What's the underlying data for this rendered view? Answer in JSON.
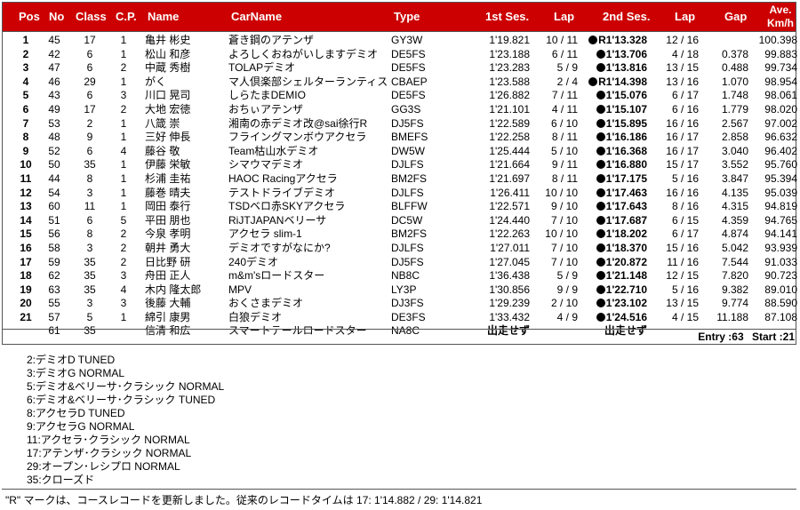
{
  "header": {
    "pos": "Pos",
    "no": "No",
    "class": "Class",
    "cp": "C.P.",
    "name": "Name",
    "carname": "CarName",
    "type": "Type",
    "ses1": "1st Ses.",
    "lap1": "Lap",
    "ses2": "2nd Ses.",
    "lap2": "Lap",
    "gap": "Gap",
    "ave1": "Ave.",
    "ave2": "Km/h"
  },
  "rows": [
    {
      "pos": "1",
      "no": "45",
      "cls": "17",
      "cp": "1",
      "name": "亀井 彬史",
      "car": "蒼き鋼のアテンザ",
      "type": "GY3W",
      "s1": "1'19.821",
      "l1": "10 / 11",
      "rec": true,
      "s2": "R1'13.328",
      "l2": "12 / 16",
      "gap": "",
      "ave": "100.398"
    },
    {
      "pos": "2",
      "no": "42",
      "cls": "6",
      "cp": "1",
      "name": "松山 和彦",
      "car": "よろしくおねがいしますデミオ",
      "type": "DE5FS",
      "s1": "1'23.188",
      "l1": "6 / 11",
      "rec": true,
      "s2": "1'13.706",
      "l2": "4 / 18",
      "gap": "0.378",
      "ave": "99.883"
    },
    {
      "pos": "3",
      "no": "47",
      "cls": "6",
      "cp": "2",
      "name": "中蔵 秀樹",
      "car": "TOLAPデミオ",
      "type": "DE5FS",
      "s1": "1'23.283",
      "l1": "5 / 9",
      "rec": true,
      "s2": "1'13.816",
      "l2": "13 / 15",
      "gap": "0.488",
      "ave": "99.734"
    },
    {
      "pos": "4",
      "no": "46",
      "cls": "29",
      "cp": "1",
      "name": "がく",
      "car": "マ人倶楽部シェルターランティス",
      "type": "CBAEP",
      "s1": "1'23.588",
      "l1": "2 / 4",
      "rec": true,
      "s2": "R1'14.398",
      "l2": "13 / 16",
      "gap": "1.070",
      "ave": "98.954"
    },
    {
      "pos": "5",
      "no": "43",
      "cls": "6",
      "cp": "3",
      "name": "川口 晃司",
      "car": "しらたまDEMIO",
      "type": "DE5FS",
      "s1": "1'26.882",
      "l1": "7 / 11",
      "rec": true,
      "s2": "1'15.076",
      "l2": "6 / 17",
      "gap": "1.748",
      "ave": "98.061"
    },
    {
      "pos": "6",
      "no": "49",
      "cls": "17",
      "cp": "2",
      "name": "大地 宏徳",
      "car": "おちぃアテンザ",
      "type": "GG3S",
      "s1": "1'21.101",
      "l1": "4 / 11",
      "rec": true,
      "s2": "1'15.107",
      "l2": "6 / 16",
      "gap": "1.779",
      "ave": "98.020"
    },
    {
      "pos": "7",
      "no": "53",
      "cls": "2",
      "cp": "1",
      "name": "八箴 崇",
      "car": "湘南の赤デミオ改@sai徐行R",
      "type": "DJ5FS",
      "s1": "1'22.589",
      "l1": "6 / 10",
      "rec": true,
      "s2": "1'15.895",
      "l2": "16 / 16",
      "gap": "2.567",
      "ave": "97.002"
    },
    {
      "pos": "8",
      "no": "48",
      "cls": "9",
      "cp": "1",
      "name": "三好 伸長",
      "car": "フライングマンボウアクセラ",
      "type": "BMEFS",
      "s1": "1'22.258",
      "l1": "8 / 11",
      "rec": true,
      "s2": "1'16.186",
      "l2": "16 / 17",
      "gap": "2.858",
      "ave": "96.632"
    },
    {
      "pos": "9",
      "no": "52",
      "cls": "6",
      "cp": "4",
      "name": "藤谷 敬",
      "car": "Team枯山水デミオ",
      "type": "DW5W",
      "s1": "1'25.444",
      "l1": "5 / 10",
      "rec": true,
      "s2": "1'16.368",
      "l2": "16 / 17",
      "gap": "3.040",
      "ave": "96.402"
    },
    {
      "pos": "10",
      "no": "50",
      "cls": "35",
      "cp": "1",
      "name": "伊藤 栄敏",
      "car": "シマウマデミオ",
      "type": "DJLFS",
      "s1": "1'21.664",
      "l1": "9 / 11",
      "rec": true,
      "s2": "1'16.880",
      "l2": "15 / 17",
      "gap": "3.552",
      "ave": "95.760"
    },
    {
      "pos": "11",
      "no": "44",
      "cls": "8",
      "cp": "1",
      "name": "杉浦 圭祐",
      "car": "HAOC Racingアクセラ",
      "type": "BM2FS",
      "s1": "1'21.697",
      "l1": "8 / 11",
      "rec": true,
      "s2": "1'17.175",
      "l2": "5 / 16",
      "gap": "3.847",
      "ave": "95.394"
    },
    {
      "pos": "12",
      "no": "54",
      "cls": "3",
      "cp": "1",
      "name": "藤巻 晴夫",
      "car": "テストドライブデミオ",
      "type": "DJLFS",
      "s1": "1'26.411",
      "l1": "10 / 10",
      "rec": true,
      "s2": "1'17.463",
      "l2": "16 / 16",
      "gap": "4.135",
      "ave": "95.039"
    },
    {
      "pos": "13",
      "no": "60",
      "cls": "11",
      "cp": "1",
      "name": "岡田 泰行",
      "car": "TSDベロ赤SKYアクセラ",
      "type": "BLFFW",
      "s1": "1'22.571",
      "l1": "9 / 10",
      "rec": true,
      "s2": "1'17.643",
      "l2": "8 / 16",
      "gap": "4.315",
      "ave": "94.819"
    },
    {
      "pos": "14",
      "no": "51",
      "cls": "6",
      "cp": "5",
      "name": "平田 朋也",
      "car": "RiJTJAPANベリーサ",
      "type": "DC5W",
      "s1": "1'24.440",
      "l1": "7 / 10",
      "rec": true,
      "s2": "1'17.687",
      "l2": "6 / 15",
      "gap": "4.359",
      "ave": "94.765"
    },
    {
      "pos": "15",
      "no": "56",
      "cls": "8",
      "cp": "2",
      "name": "今泉 孝明",
      "car": "アクセラ slim-1",
      "type": "BM2FS",
      "s1": "1'22.263",
      "l1": "10 / 10",
      "rec": true,
      "s2": "1'18.202",
      "l2": "6 / 17",
      "gap": "4.874",
      "ave": "94.141"
    },
    {
      "pos": "16",
      "no": "58",
      "cls": "3",
      "cp": "2",
      "name": "朝井 勇大",
      "car": "デミオですがなにか?",
      "type": "DJLFS",
      "s1": "1'27.011",
      "l1": "7 / 10",
      "rec": true,
      "s2": "1'18.370",
      "l2": "15 / 16",
      "gap": "5.042",
      "ave": "93.939"
    },
    {
      "pos": "17",
      "no": "59",
      "cls": "35",
      "cp": "2",
      "name": "日比野 研",
      "car": "240デミオ",
      "type": "DJ5FS",
      "s1": "1'27.045",
      "l1": "7 / 10",
      "rec": true,
      "s2": "1'20.872",
      "l2": "11 / 16",
      "gap": "7.544",
      "ave": "91.033"
    },
    {
      "pos": "18",
      "no": "62",
      "cls": "35",
      "cp": "3",
      "name": "舟田 正人",
      "car": "m&m'sロードスター",
      "type": "NB8C",
      "s1": "1'36.438",
      "l1": "5 / 9",
      "rec": true,
      "s2": "1'21.148",
      "l2": "12 / 15",
      "gap": "7.820",
      "ave": "90.723"
    },
    {
      "pos": "19",
      "no": "63",
      "cls": "35",
      "cp": "4",
      "name": "木内 隆太郎",
      "car": "MPV",
      "type": "LY3P",
      "s1": "1'30.856",
      "l1": "9 / 9",
      "rec": true,
      "s2": "1'22.710",
      "l2": "5 / 16",
      "gap": "9.382",
      "ave": "89.010"
    },
    {
      "pos": "20",
      "no": "55",
      "cls": "3",
      "cp": "3",
      "name": "後藤 大輔",
      "car": "おくさまデミオ",
      "type": "DJ3FS",
      "s1": "1'29.239",
      "l1": "2 / 10",
      "rec": true,
      "s2": "1'23.102",
      "l2": "13 / 15",
      "gap": "9.774",
      "ave": "88.590"
    },
    {
      "pos": "21",
      "no": "57",
      "cls": "5",
      "cp": "1",
      "name": "綿引 康男",
      "car": "白狼デミオ",
      "type": "DE3FS",
      "s1": "1'33.432",
      "l1": "4 / 9",
      "rec": true,
      "s2": "1'24.516",
      "l2": "4 / 15",
      "gap": "11.188",
      "ave": "87.108"
    },
    {
      "pos": "",
      "no": "61",
      "cls": "35",
      "cp": "",
      "name": "信清 和広",
      "car": "スマートテールロードスター",
      "type": "NA8C",
      "s1": "出走せず",
      "l1": "",
      "rec": false,
      "s2": "出走せず",
      "l2": "",
      "gap": "",
      "ave": "",
      "dns": true
    }
  ],
  "entry": {
    "entry": "Entry :63",
    "start": "Start :21"
  },
  "legend": [
    "2:デミオD TUNED",
    "3:デミオG NORMAL",
    "5:デミオ&ベリーサ･クラシック NORMAL",
    "6:デミオ&ベリーサ･クラシック TUNED",
    "8:アクセラD TUNED",
    "9:アクセラG NORMAL",
    "11:アクセラ･クラシック NORMAL",
    "17:アテンザ･クラシック NORMAL",
    "29:オープン･レシプロ NORMAL",
    "35:クローズド"
  ],
  "note": "\"R\" マークは、コースレコードを更新しました。従来のレコードタイムは 17: 1'14.882 / 29: 1'14.821"
}
